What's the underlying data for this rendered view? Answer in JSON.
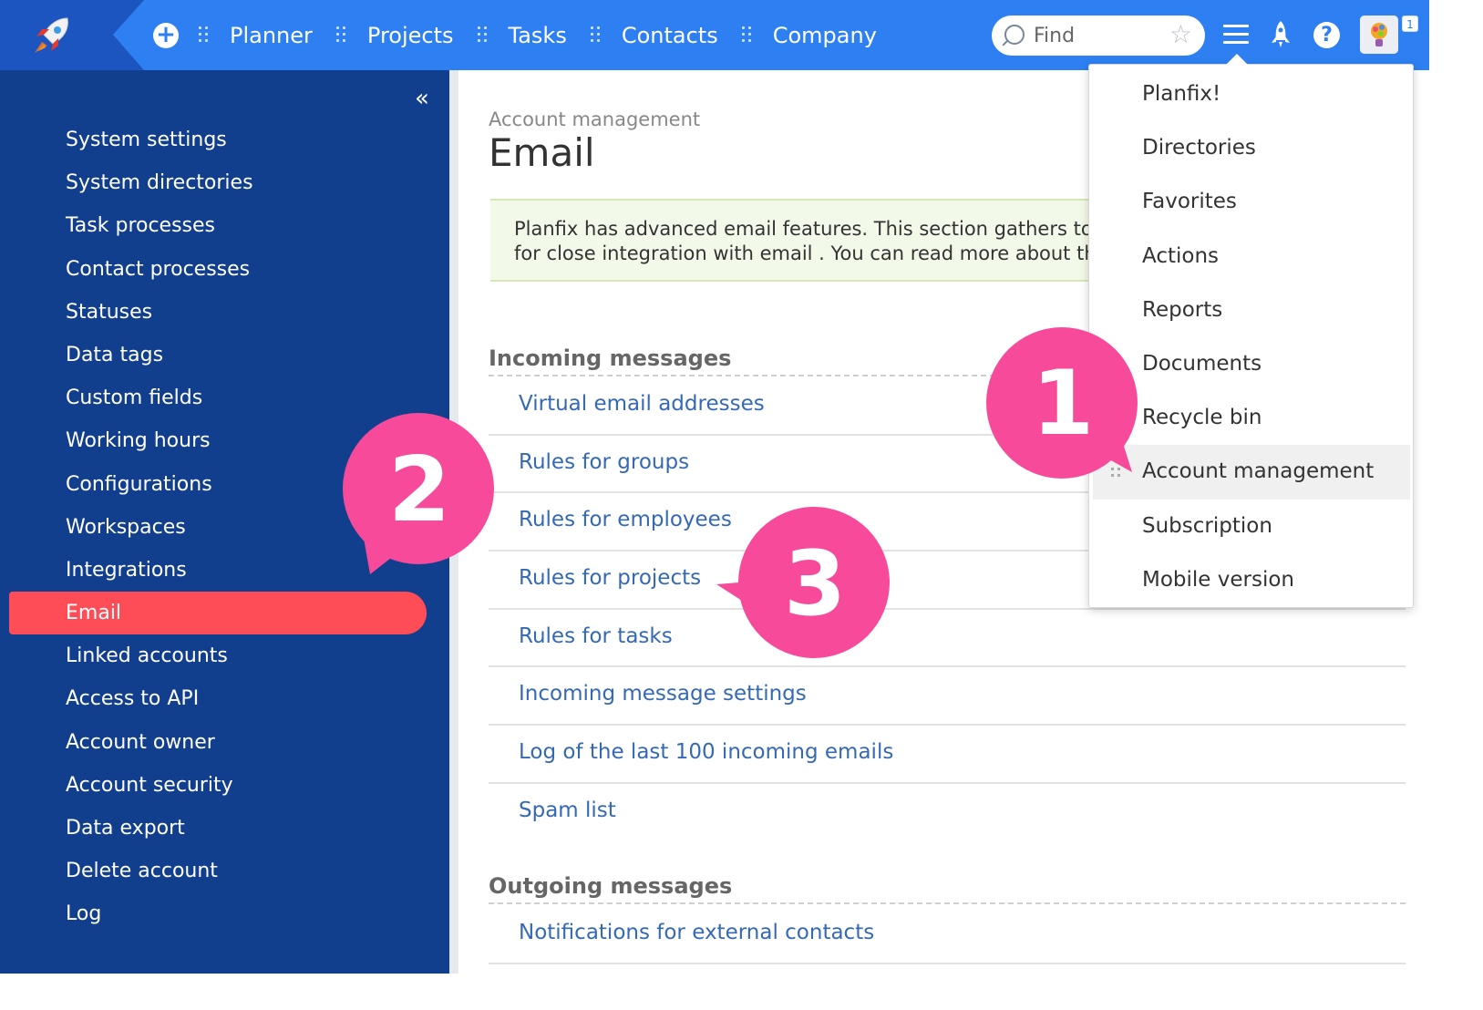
{
  "topbar": {
    "nav": [
      "Planner",
      "Projects",
      "Tasks",
      "Contacts",
      "Company"
    ],
    "search_placeholder": "Find",
    "notification_count": "1",
    "accent_color": "#2e7ff1"
  },
  "sidebar": {
    "items": [
      "System settings",
      "System directories",
      "Task processes",
      "Contact processes",
      "Statuses",
      "Data tags",
      "Custom fields",
      "Working hours",
      "Configurations",
      "Workspaces",
      "Integrations",
      "Email",
      "Linked accounts",
      "Access to API",
      "Account owner",
      "Account security",
      "Data export",
      "Delete account",
      "Log"
    ],
    "active": "Email",
    "active_color": "#ff4d58",
    "background": "#123f8d"
  },
  "main": {
    "breadcrumb": "Account management",
    "title": "Email",
    "notice_line1": "Planfix has advanced email features. This section gathers toge",
    "notice_line2": "for close integration with email . You can read more about ther",
    "incoming_title": "Incoming messages",
    "incoming_links": [
      "Virtual email addresses",
      "Rules for groups",
      "Rules for employees",
      "Rules for projects",
      "Rules for tasks",
      "Incoming message settings",
      "Log of the last 100 incoming emails",
      "Spam list"
    ],
    "outgoing_title": "Outgoing messages",
    "outgoing_links": [
      "Notifications for external contacts"
    ]
  },
  "dropdown": {
    "items": [
      "Planfix!",
      "Directories",
      "Favorites",
      "Actions",
      "Reports",
      "Documents",
      "Recycle bin",
      "Account management",
      "Subscription",
      "Mobile version"
    ],
    "highlighted": "Account management"
  },
  "callouts": [
    "1",
    "2",
    "3"
  ],
  "callout_color": "#f74a9a"
}
